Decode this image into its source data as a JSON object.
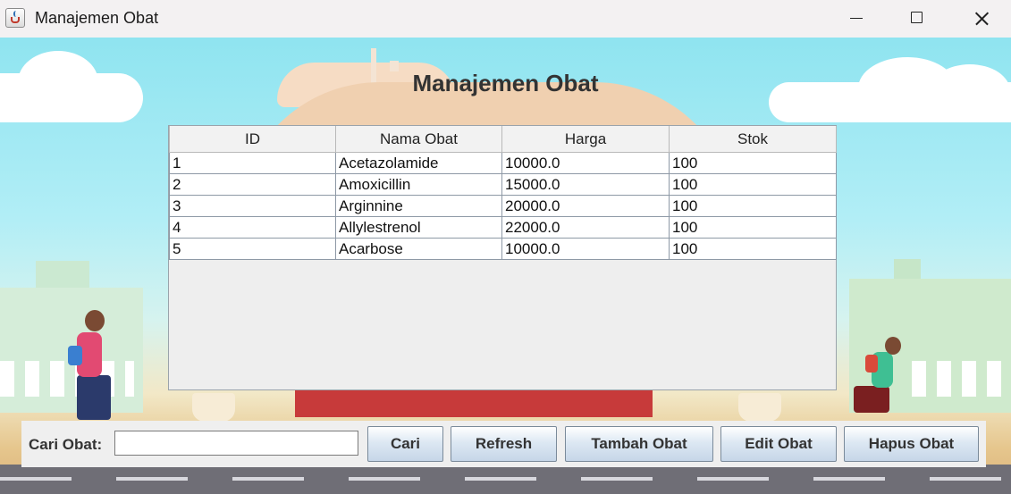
{
  "window": {
    "title": "Manajemen Obat"
  },
  "page": {
    "heading": "Manajemen Obat"
  },
  "table": {
    "columns": [
      "ID",
      "Nama Obat",
      "Harga",
      "Stok"
    ],
    "rows": [
      {
        "id": "1",
        "nama": "Acetazolamide",
        "harga": "10000.0",
        "stok": "100"
      },
      {
        "id": "2",
        "nama": "Amoxicillin",
        "harga": "15000.0",
        "stok": "100"
      },
      {
        "id": "3",
        "nama": "Arginnine",
        "harga": "20000.0",
        "stok": "100"
      },
      {
        "id": "4",
        "nama": "Allylestrenol",
        "harga": "22000.0",
        "stok": "100"
      },
      {
        "id": "5",
        "nama": "Acarbose",
        "harga": "10000.0",
        "stok": "100"
      }
    ]
  },
  "search": {
    "label": "Cari Obat:",
    "value": ""
  },
  "buttons": {
    "cari": "Cari",
    "refresh": "Refresh",
    "tambah": "Tambah Obat",
    "edit": "Edit Obat",
    "hapus": "Hapus Obat"
  },
  "icons": {
    "app": "java-coffee-cup-icon",
    "minimize": "minimize-icon",
    "maximize": "maximize-icon",
    "close": "close-icon"
  },
  "colors": {
    "sky": "#8fe4f0",
    "button_gradient_bottom": "#c6d6e8",
    "panel_bg": "#efefef"
  }
}
